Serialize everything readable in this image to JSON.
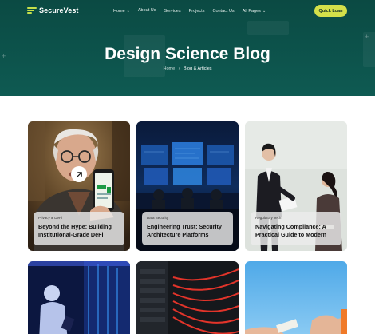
{
  "brand": {
    "name": "SecureVest",
    "accent": "#d4e04a",
    "hero_bg": "#0e5a52"
  },
  "nav": {
    "items": [
      {
        "label": "Home",
        "has_dropdown": true
      },
      {
        "label": "About Us",
        "active": true
      },
      {
        "label": "Services"
      },
      {
        "label": "Projects"
      },
      {
        "label": "Contact Us"
      },
      {
        "label": "All Pages",
        "has_dropdown": true
      }
    ],
    "cta_label": "Quick Loan"
  },
  "hero": {
    "title": "Design Science Blog",
    "breadcrumb": {
      "home": "Home",
      "separator": "›",
      "current": "Blog & Articles"
    }
  },
  "posts": [
    {
      "category": "Privacy & DeFi",
      "title": "Beyond the Hype: Building Institutional-Grade DeFi",
      "icon": "arrow-up-right-icon"
    },
    {
      "category": "Data Security",
      "title": "Engineering Trust: Security Architecture Platforms"
    },
    {
      "category": "Regulatory Tech",
      "title": "Navigating Compliance: A Practical Guide to Modern"
    },
    {
      "category": "",
      "title": ""
    },
    {
      "category": "",
      "title": ""
    },
    {
      "category": "",
      "title": ""
    }
  ]
}
